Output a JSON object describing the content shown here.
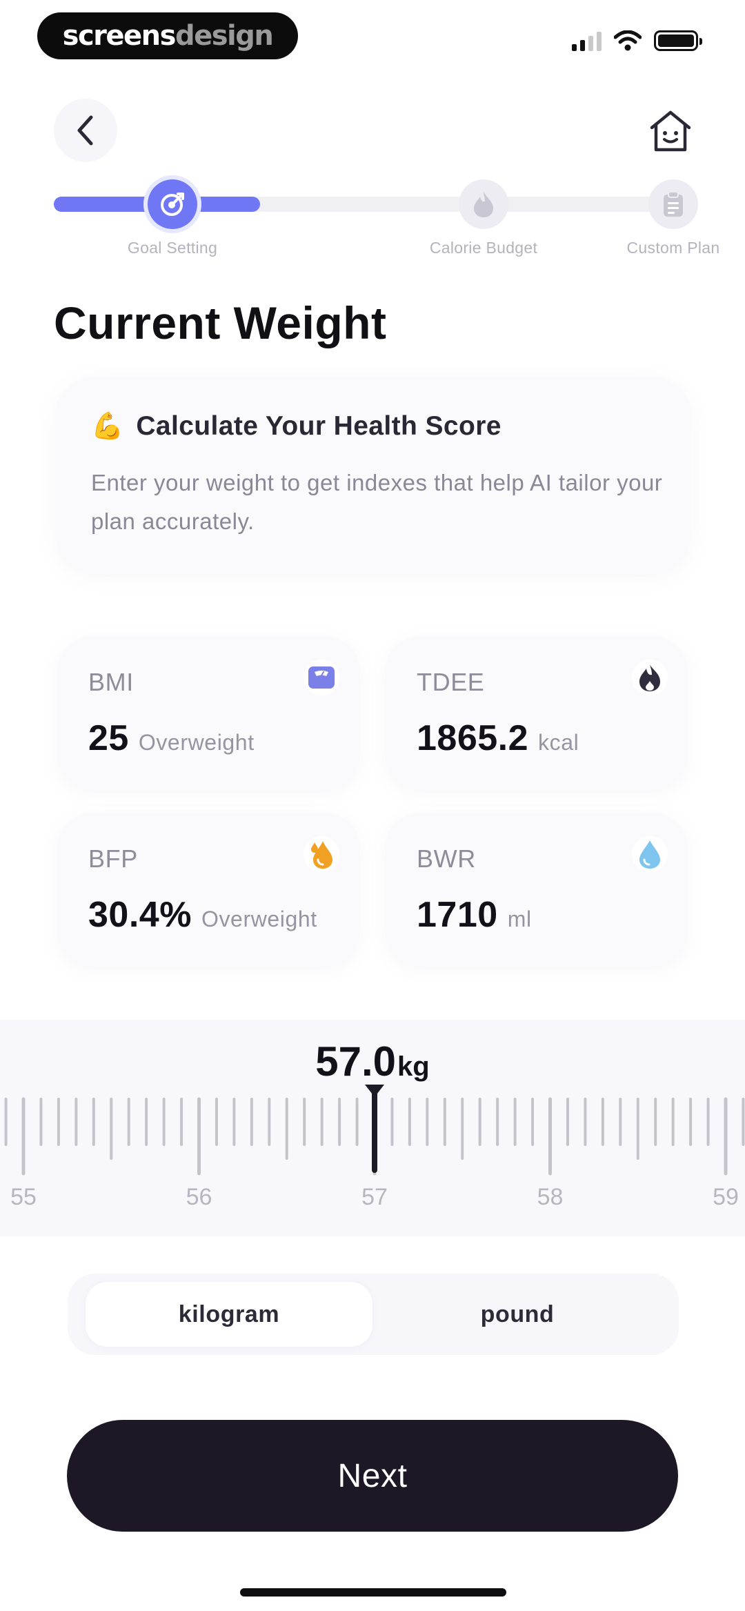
{
  "status_bar": {
    "brand_part1": "screens",
    "brand_part2": "design",
    "icons": [
      "cellular-signal-icon",
      "wifi-icon",
      "battery-icon"
    ]
  },
  "header": {
    "back_icon": "chevron-left-icon",
    "home_icon": "smiling-house-icon"
  },
  "progress": {
    "fill_fraction": 0.32,
    "steps": [
      {
        "label": "Goal Setting",
        "icon": "target-icon",
        "state": "active"
      },
      {
        "label": "Calorie Budget",
        "icon": "flame-icon",
        "state": "upcoming"
      },
      {
        "label": "Custom Plan",
        "icon": "clipboard-icon",
        "state": "upcoming"
      }
    ]
  },
  "page_title": "Current Weight",
  "info_card": {
    "emoji": "💪",
    "title": "Calculate Your Health Score",
    "body": "Enter your weight to get indexes that help AI tailor your plan accurately."
  },
  "metrics": [
    {
      "label": "BMI",
      "value": "25",
      "unit": "Overweight",
      "icon": "scale-icon",
      "icon_color": "#7b80e8"
    },
    {
      "label": "TDEE",
      "value": "1865.2",
      "unit": "kcal",
      "icon": "fire-icon",
      "icon_color": "#2f2d3d"
    },
    {
      "label": "BFP",
      "value": "30.4%",
      "unit": "Overweight",
      "icon": "oil-drop-icon",
      "icon_color": "#f0a022"
    },
    {
      "label": "BWR",
      "value": "1710",
      "unit": "ml",
      "icon": "water-drop-icon",
      "icon_color": "#7dc4ee"
    }
  ],
  "weight_picker": {
    "value": "57.0",
    "unit": "kg",
    "selected": 57.0,
    "min_visible": 55,
    "max_visible": 59,
    "tick_labels": [
      "55",
      "56",
      "57",
      "58",
      "59"
    ]
  },
  "unit_toggle": {
    "options": [
      {
        "label": "kilogram",
        "selected": true
      },
      {
        "label": "pound",
        "selected": false
      }
    ]
  },
  "next_button": {
    "label": "Next"
  },
  "colors": {
    "accent": "#6f77f5",
    "button_dark": "#1e1726"
  }
}
